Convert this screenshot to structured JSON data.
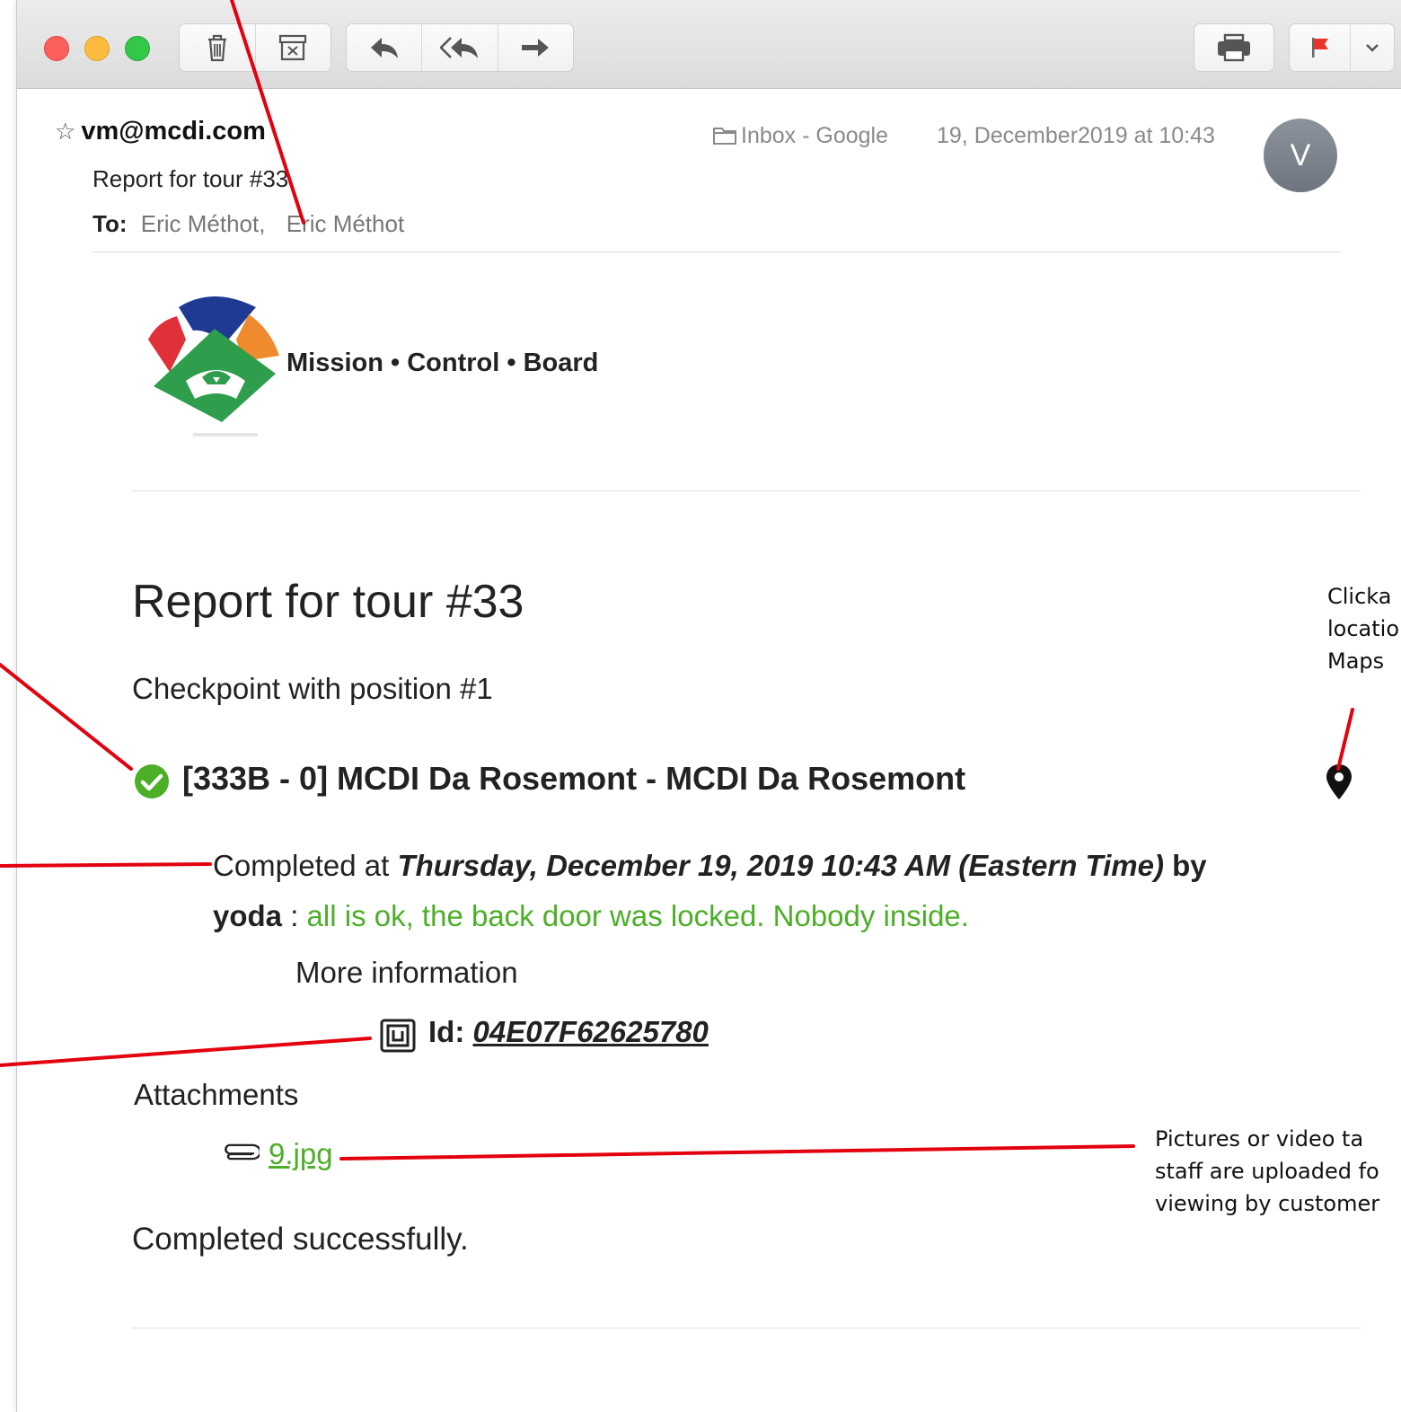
{
  "toolbar": {
    "buttons": [
      "trash-icon",
      "archive-icon",
      "reply-icon",
      "reply-all-icon",
      "forward-icon",
      "print-icon",
      "flag-icon",
      "chevron-down-icon"
    ]
  },
  "header": {
    "from": "vm@mcdi.com",
    "subject": "Report for tour #33",
    "to_label": "To:",
    "recipients": [
      "Eric Méthot,",
      "Eric Méthot"
    ],
    "mailbox": "Inbox - Google",
    "date": "19, December2019 at 10:43",
    "avatar_initial": "V"
  },
  "brand": {
    "name": "Mission • Control • Board"
  },
  "report": {
    "title": "Report for tour #33",
    "checkpoint_heading": "Checkpoint with position #1",
    "checkpoint_name": "[333B - 0] MCDI Da Rosemont - MCDI Da Rosemont",
    "completed_prefix": "Completed at",
    "completed_time": "Thursday, December 19, 2019 10:43 AM (Eastern Time)",
    "by": "by",
    "user": "yoda",
    "sep": ":",
    "note": "all is ok, the back door was locked. Nobody inside.",
    "more_info": "More information",
    "id_label": "Id:",
    "id_value": "04E07F62625780",
    "attachments_title": "Attachments",
    "attachment": "9.jpg",
    "done": "Completed successfully."
  },
  "annotations": {
    "map_lines": [
      "Clicka",
      "locatio",
      "Maps"
    ],
    "media_lines": [
      "Pictures or video ta",
      "staff are uploaded fo",
      "viewing by customer"
    ]
  },
  "colors": {
    "accent_green": "#4caf27",
    "callout_red": "#e3000f"
  }
}
